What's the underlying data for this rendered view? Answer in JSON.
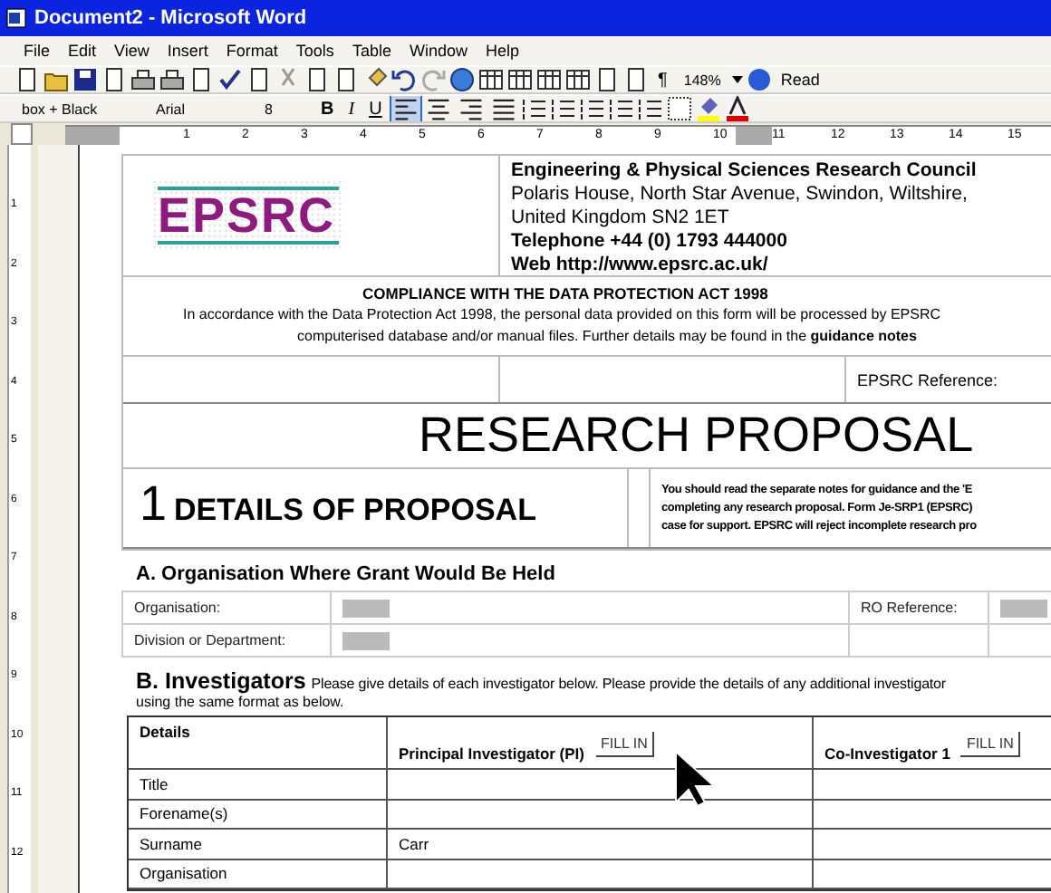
{
  "window": {
    "title": "Document2 - Microsoft Word"
  },
  "menu": [
    "File",
    "Edit",
    "View",
    "Insert",
    "Format",
    "Tools",
    "Table",
    "Window",
    "Help"
  ],
  "standard_toolbar": {
    "zoom": "148%",
    "show_marks": "¶",
    "read_button": "Read"
  },
  "formatting_toolbar": {
    "style": "box + Black",
    "font": "Arial",
    "size": "8",
    "bold": "B",
    "italic": "I",
    "underline": "U",
    "alignment": [
      {
        "selected": true
      },
      {
        "selected": false
      },
      {
        "selected": false
      },
      {
        "selected": false
      }
    ]
  },
  "ruler": {
    "marks": [
      "1",
      "2",
      "3",
      "4",
      "5",
      "6",
      "7",
      "8",
      "9",
      "10",
      "11",
      "12",
      "13",
      "14",
      "15"
    ]
  },
  "vertical_ruler": {
    "marks": [
      "1",
      "2",
      "3",
      "4",
      "5",
      "6",
      "7",
      "8",
      "9",
      "10",
      "11",
      "12"
    ]
  },
  "header": {
    "logo": "EPSRC",
    "org_name": "Engineering & Physical Sciences Research Council",
    "address_lines": [
      "Polaris House, North Star Avenue, Swindon, Wiltshire,",
      "United Kingdom  SN2 1ET"
    ],
    "telephone": "Telephone +44 (0) 1793 444000",
    "web": "Web http://www.epsrc.ac.uk/"
  },
  "data_protection": {
    "title": "COMPLIANCE WITH THE DATA PROTECTION ACT 1998",
    "lines": [
      "In accordance with the Data Protection Act 1998, the personal data provided on this form will be processed by EPSRC",
      "computerised database and/or manual files.  Further details may be found in the **guidance notes**"
    ]
  },
  "reference": {
    "label": "EPSRC Reference:"
  },
  "title": "RESEARCH PROPOSAL",
  "section_1": {
    "number": "1",
    "heading": "DETAILS OF PROPOSAL",
    "notes": [
      "You should read the separate notes for guidance and the 'E",
      "completing any research proposal.  Form Je-SRP1 (EPSRC)",
      "case for support.  EPSRC will reject incomplete research pro"
    ]
  },
  "section_a": {
    "heading": "A. Organisation Where Grant Would Be Held",
    "rows": [
      {
        "label": "Organisation:",
        "extra_label": "RO Reference:"
      },
      {
        "label": "Division or Department:"
      }
    ]
  },
  "section_b": {
    "heading": "B. Investigators",
    "text": "Please give details of each investigator below.  Please provide the details of any additional investigator",
    "text_2": "using the same format as below.",
    "columns": [
      {
        "title": "Details"
      },
      {
        "title": "Principal Investigator (PI)",
        "button": "FILL IN"
      },
      {
        "title": "Co-Investigator 1",
        "button": "FILL IN"
      }
    ],
    "rows": [
      {
        "label": "Title"
      },
      {
        "label": "Forename(s)"
      },
      {
        "label": "Surname",
        "pi": "Carr"
      },
      {
        "label": "Organisation"
      }
    ]
  }
}
